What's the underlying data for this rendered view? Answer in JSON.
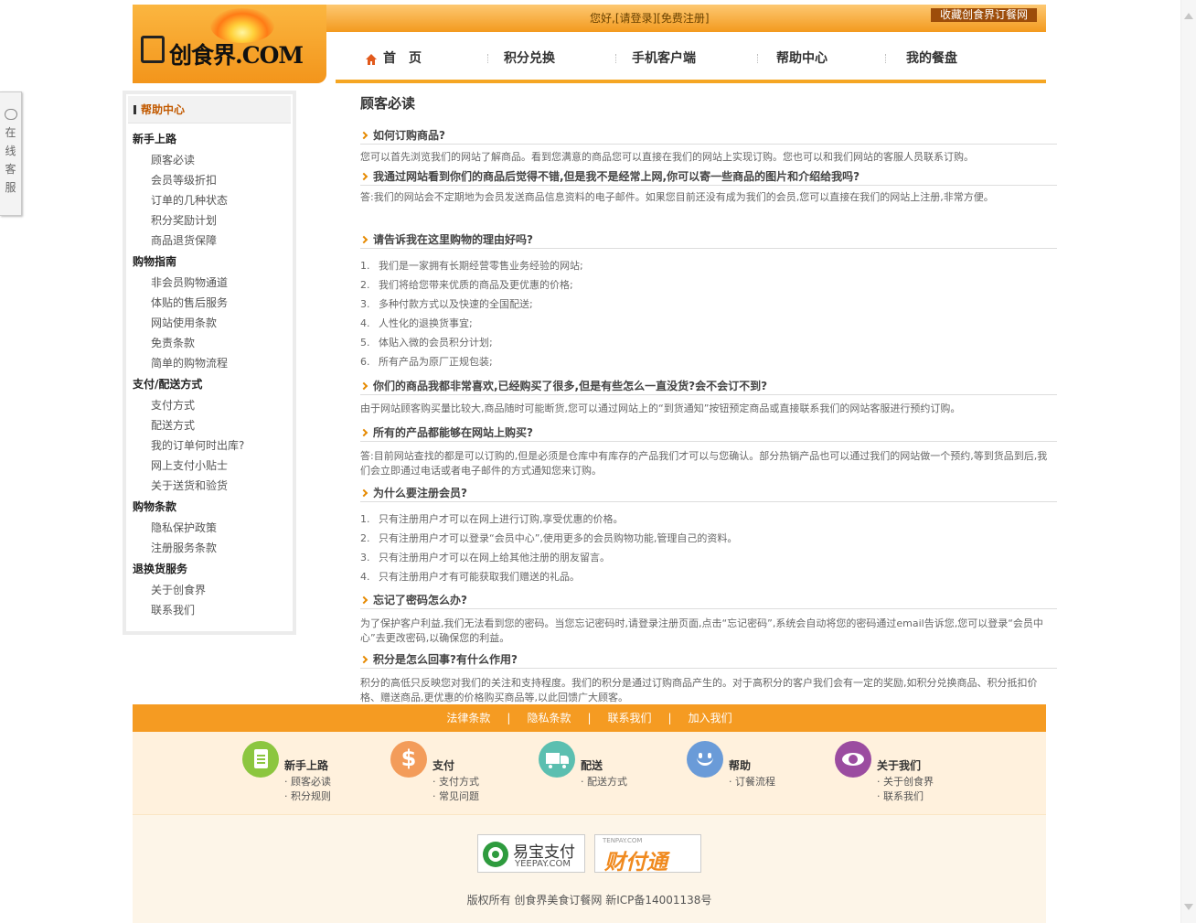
{
  "service_tab": {
    "chars": [
      "在",
      "线",
      "客",
      "服"
    ]
  },
  "header": {
    "logo_text": "创食界.COM",
    "welcome_prefix": "您好,",
    "login_link": "[请登录]",
    "register_link": "[免费注册]",
    "favorite": "收藏创食界订餐网",
    "nav": [
      "首页",
      "积分兑换",
      "手机客户端",
      "帮助中心",
      "我的餐盘"
    ]
  },
  "sidebar": {
    "title": "帮助中心",
    "sections": [
      {
        "title": "新手上路",
        "items": [
          "顾客必读",
          "会员等级折扣",
          "订单的几种状态",
          "积分奖励计划",
          "商品退货保障"
        ]
      },
      {
        "title": "购物指南",
        "items": [
          "非会员购物通道",
          "体贴的售后服务",
          "网站使用条款",
          "免责条款",
          "简单的购物流程"
        ]
      },
      {
        "title": "支付/配送方式",
        "items": [
          "支付方式",
          "配送方式",
          "我的订单何时出库?",
          "网上支付小贴士",
          "关于送货和验货"
        ]
      },
      {
        "title": "购物条款",
        "items": [
          "隐私保护政策",
          "注册服务条款"
        ]
      },
      {
        "title": "退换货服务",
        "items": [
          "关于创食界",
          "联系我们"
        ]
      }
    ]
  },
  "main": {
    "title": "顾客必读",
    "faqs": [
      {
        "q": "如何订购商品?",
        "a": "您可以首先浏览我们的网站了解商品。看到您满意的商品您可以直接在我们的网站上实现订购。您也可以和我们网站的客服人员联系订购。"
      },
      {
        "q": "我通过网站看到你们的商品后觉得不错,但是我不是经常上网,你可以寄一些商品的图片和介绍给我吗?",
        "a": "答:我们的网站会不定期地为会员发送商品信息资料的电子邮件。如果您目前还没有成为我们的会员,您可以直接在我们的网站上注册,非常方便。"
      },
      {
        "q": "请告诉我在这里购物的理由好吗?",
        "list": [
          "我们是一家拥有长期经营零售业务经验的网站;",
          "我们将给您带来优质的商品及更优惠的价格;",
          "多种付款方式以及快速的全国配送;",
          "人性化的退换货事宜;",
          "体贴入微的会员积分计划;",
          "所有产品为原厂正规包装;"
        ]
      },
      {
        "q": "你们的商品我都非常喜欢,已经购买了很多,但是有些怎么一直没货?会不会订不到?",
        "a": "由于网站顾客购买量比较大,商品随时可能断货,您可以通过网站上的“到货通知”按钮预定商品或直接联系我们的网站客服进行预约订购。"
      },
      {
        "q": "所有的产品都能够在网站上购买?",
        "a": "答:目前网站查找的都是可以订购的,但是必须是仓库中有库存的产品我们才可以与您确认。部分热销产品也可以通过我们的网站做一个预约,等到货品到后,我们会立即通过电话或者电子邮件的方式通知您来订购。"
      },
      {
        "q": "为什么要注册会员?",
        "list": [
          "只有注册用户才可以在网上进行订购,享受优惠的价格。",
          "只有注册用户才可以登录“会员中心”,使用更多的会员购物功能,管理自己的资料。",
          "只有注册用户才可以在网上给其他注册的朋友留言。",
          "只有注册用户才有可能获取我们赠送的礼品。"
        ]
      },
      {
        "q": "忘记了密码怎么办?",
        "a": "为了保护客户利益,我们无法看到您的密码。当您忘记密码时,请登录注册页面,点击“忘记密码”,系统会自动将您的密码通过email告诉您,您可以登录“会员中心”去更改密码,以确保您的利益。"
      },
      {
        "q": "积分是怎么回事?有什么作用?",
        "a": "积分的高低只反映您对我们的关注和支持程度。我们的积分是通过订购商品产生的。对于高积分的客户我们会有一定的奖励,如积分兑换商品、积分抵扣价格、赠送商品,更优惠的价格购买商品等,以此回馈广大顾客。"
      }
    ]
  },
  "footer": {
    "links": [
      "法律条款",
      "隐私条款",
      "联系我们",
      "加入我们"
    ],
    "columns": [
      {
        "title": "新手上路",
        "links": [
          "· 顾客必读",
          "· 积分规则"
        ],
        "color": "#8cc63f"
      },
      {
        "title": "支付",
        "links": [
          "· 支付方式",
          "· 常见问题"
        ],
        "color": "#f39c5a"
      },
      {
        "title": "配送",
        "links": [
          "· 配送方式"
        ],
        "color": "#5bbfb0"
      },
      {
        "title": "帮助",
        "links": [
          "· 订餐流程"
        ],
        "color": "#6a9bd8"
      },
      {
        "title": "关于我们",
        "links": [
          "· 关于创食界",
          "· 联系我们"
        ],
        "color": "#9b4ca0"
      }
    ],
    "yeepay_cn": "易宝支付",
    "yeepay_en": "YEEPAY.COM",
    "tenpay_small": "TENPAY.COM",
    "tenpay_cn": "财付通",
    "copyright": "版权所有  创食界美食订餐网    新ICP备14001138号"
  }
}
